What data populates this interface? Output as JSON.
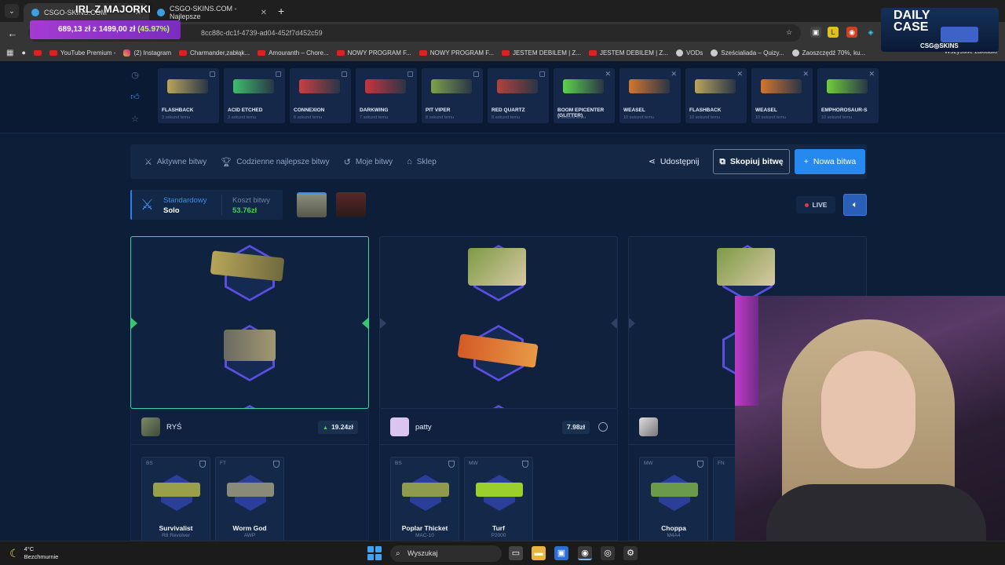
{
  "browser": {
    "tabs": [
      {
        "title": "CSGO-SKINS.COM"
      },
      {
        "title": "CSGO-SKINS.COM - Najlepsze"
      }
    ],
    "url_fragment": "8cc88c-dc1f-4739-ad04-452f7d452c59",
    "bookmarks": [
      {
        "label": "YouTube Premium -",
        "icon": "youtube"
      },
      {
        "label": "(2) Instagram",
        "icon": "instagram"
      },
      {
        "label": "Charmander,zabłąk...",
        "icon": "youtube"
      },
      {
        "label": "Amouranth – Chore...",
        "icon": "youtube"
      },
      {
        "label": "NOWY PROGRAM F...",
        "icon": "youtube"
      },
      {
        "label": "NOWY PROGRAM F...",
        "icon": "youtube"
      },
      {
        "label": "JESTEM DEBILEM | Z...",
        "icon": "youtube"
      },
      {
        "label": "JESTEM DEBILEM | Z...",
        "icon": "youtube"
      },
      {
        "label": "VODs",
        "icon": "globe"
      },
      {
        "label": "Sześcialiada – Quizy...",
        "icon": "globe"
      },
      {
        "label": "Zaoszczędź 70%, ku...",
        "icon": "globe"
      }
    ],
    "bookmarks_all": "Wszystkie zakładki"
  },
  "stream_overlay": {
    "title": "IRL Z MAJORKI",
    "price_current": "689,13 zł",
    "price_sep": "z",
    "price_goal": "1499,00 zł",
    "price_pct": "(45.97%)",
    "daily_case_line1": "DAILY",
    "daily_case_line2": "CASE",
    "daily_case_brand": "CSG◎SKINS"
  },
  "live_drops": {
    "items": [
      {
        "name": "FLASHBACK",
        "time": "3 sekund temu",
        "color": "#b8a55a"
      },
      {
        "name": "ACID ETCHED",
        "time": "3 sekund temu",
        "color": "#3cc06a"
      },
      {
        "name": "CONNEXION",
        "time": "6 sekund temu",
        "color": "#c94040"
      },
      {
        "name": "DARKWING",
        "time": "7 sekund temu",
        "color": "#c8343e"
      },
      {
        "name": "PIT VIPER",
        "time": "8 sekund temu",
        "color": "#7ea14b"
      },
      {
        "name": "RED QUARTZ",
        "time": "8 sekund temu",
        "color": "#b2433a"
      },
      {
        "name": "BOOM EPICENTER (GLITTER)",
        "time": "9 sekund temu",
        "color": "#5cd44a"
      },
      {
        "name": "WEASEL",
        "time": "10 sekund temu",
        "color": "#d4762c"
      },
      {
        "name": "FLASHBACK",
        "time": "10 sekund temu",
        "color": "#b8a55a"
      },
      {
        "name": "WEASEL",
        "time": "10 sekund temu",
        "color": "#d4762c"
      },
      {
        "name": "EMPHOROSAUR-S",
        "time": "10 sekund temu",
        "color": "#6fcf3a"
      }
    ]
  },
  "nav": {
    "active_battles": "Aktywne bitwy",
    "daily_best": "Codzienne najlepsze bitwy",
    "my_battles": "Moje bitwy",
    "shop": "Sklep",
    "share": "Udostępnij",
    "copy": "Skopiuj bitwę",
    "new": "Nowa bitwa"
  },
  "battle": {
    "mode_label": "Standardowy",
    "mode_value": "Solo",
    "cost_label": "Koszt bitwy",
    "cost_value": "53.76zł",
    "live": "LIVE"
  },
  "players": [
    {
      "name": "RYŚ",
      "value": "19.24zł",
      "winner": true,
      "items": [
        {
          "condition": "BS",
          "name": "Survivalist",
          "type": "R8 Revolver",
          "color": "#9aa04a"
        },
        {
          "condition": "FT",
          "name": "Worm God",
          "type": "AWP",
          "color": "#8a8a78"
        }
      ]
    },
    {
      "name": "patty",
      "value": "7.98zł",
      "winner": false,
      "items": [
        {
          "condition": "BS",
          "name": "Poplar Thicket",
          "type": "MAC-10",
          "color": "#8e9a4c"
        },
        {
          "condition": "MW",
          "name": "Turf",
          "type": "P2000",
          "color": "#9bcf2c"
        }
      ]
    },
    {
      "name": "",
      "value": "",
      "winner": false,
      "items": [
        {
          "condition": "MW",
          "name": "Choppa",
          "type": "M4A4",
          "color": "#6a9a4a"
        },
        {
          "condition": "FN",
          "name": "",
          "type": "",
          "color": "#aaaaaa"
        }
      ]
    }
  ],
  "taskbar": {
    "temp": "4°C",
    "weather": "Bezchmurnie",
    "search": "Wyszukaj"
  },
  "colors": {
    "accent": "#2589f0",
    "win": "#3ad4a4",
    "green": "#45d35b"
  }
}
